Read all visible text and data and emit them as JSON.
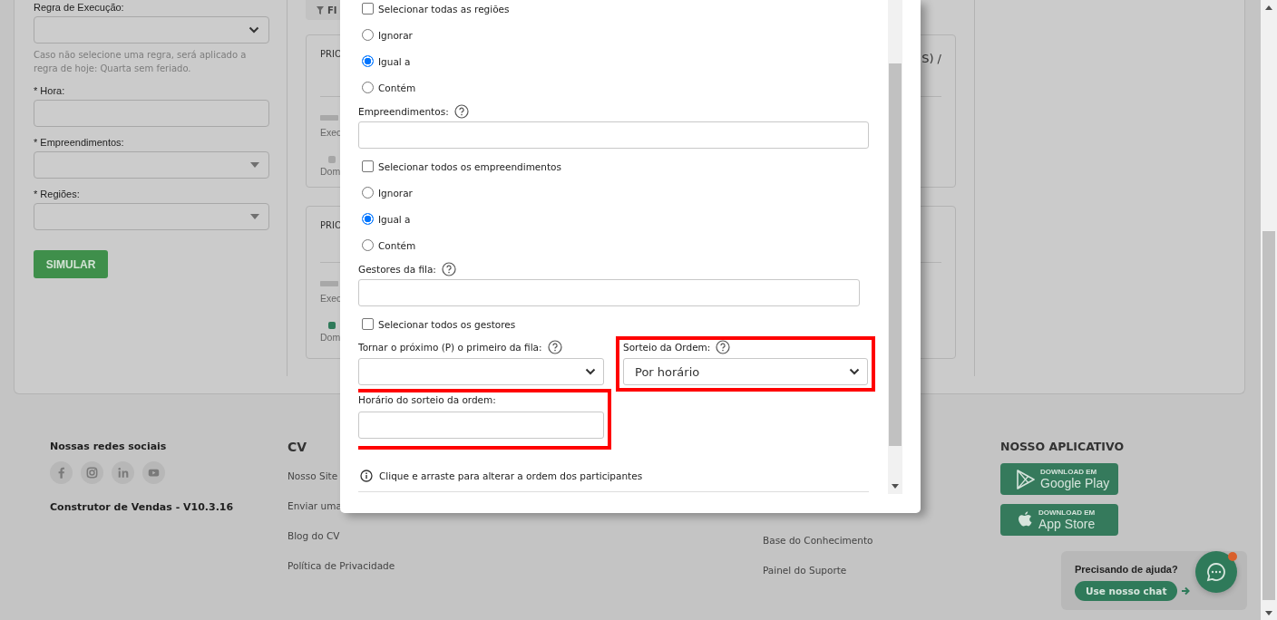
{
  "simulation_form": {
    "rule_label": "Regra de Execução:",
    "hint": "Caso não selecione uma regra, será aplicado a regra de hoje: Quarta sem feriado.",
    "fields": [
      {
        "label": "* Hora:",
        "kind": "input"
      },
      {
        "label": "* Empreendimentos:",
        "kind": "dropdown"
      },
      {
        "label": "* Regiões:",
        "kind": "dropdown"
      }
    ],
    "button": "SIMULAR"
  },
  "filter_tab": {
    "label": "FI"
  },
  "queue_cards": [
    {
      "title": "PRIO",
      "title_end": "S) /",
      "level": 1,
      "execution": "Exec",
      "day": "Dom",
      "color": "#a6a6a6"
    },
    {
      "title": "PRIO",
      "level": 1,
      "execution": "Exec",
      "day": "Dom",
      "color": "#2f7a5a"
    }
  ],
  "modal": {
    "regions": {
      "select_all": {
        "label": "Selecionar todas as regiões",
        "checked": false
      },
      "match": [
        {
          "label": "Ignorar",
          "selected": false
        },
        {
          "label": "Igual a",
          "selected": true
        },
        {
          "label": "Contém",
          "selected": false
        }
      ]
    },
    "developments": {
      "label": "Empreendimentos:",
      "select_all": {
        "label": "Selecionar todos os empreendimentos",
        "checked": false
      },
      "match": [
        {
          "label": "Ignorar",
          "selected": false
        },
        {
          "label": "Igual a",
          "selected": true
        },
        {
          "label": "Contém",
          "selected": false
        }
      ]
    },
    "managers": {
      "label": "Gestores da fila:",
      "select_all": {
        "label": "Selecionar todos os gestores",
        "checked": false
      }
    },
    "make_first": {
      "label": "Tornar o próximo (P) o primeiro da fila:",
      "highlighted": false
    },
    "draw_order": {
      "label": "Sorteio da Ordem:",
      "value": "Por horário",
      "highlighted": true
    },
    "draw_time": {
      "label": "Horário do sorteio da ordem:",
      "highlighted": true
    },
    "info": "Clique e arraste para alterar a ordem dos participantes"
  },
  "footer": {
    "social": {
      "title": "Nossas redes sociais",
      "networks": [
        {
          "kind": "facebook"
        },
        {
          "kind": "instagram"
        },
        {
          "kind": "linkedin"
        },
        {
          "kind": "youtube"
        }
      ]
    },
    "version": "Construtor de Vendas - V10.3.16",
    "cv": {
      "title": "CV",
      "links": [
        "Nosso Site",
        "Enviar uma",
        "Blog do CV",
        "Política de Privacidade"
      ]
    },
    "support_links": [
      "Base do Conhecimento",
      "Painel do Suporte"
    ],
    "app": {
      "title": "NOSSO APLICATIVO",
      "stores": [
        {
          "kind": "google-play",
          "caption": "DOWNLOAD EM",
          "name": "Google Play"
        },
        {
          "kind": "app-store",
          "caption": "DOWNLOAD EM",
          "name": "App Store"
        }
      ]
    },
    "help": {
      "question": "Precisando de ajuda?",
      "button": "Use nosso chat",
      "notification": true
    }
  }
}
